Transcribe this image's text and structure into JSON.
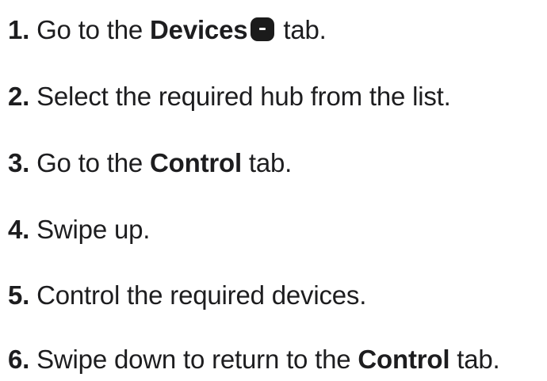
{
  "steps": [
    {
      "number": "1.",
      "text_before": " Go to the ",
      "bold": "Devices",
      "icon": "devices-tab-icon",
      "text_after": " tab."
    },
    {
      "number": "2.",
      "text": " Select the required hub from the list."
    },
    {
      "number": "3.",
      "text_before": " Go to the ",
      "bold": "Control",
      "text_after": " tab."
    },
    {
      "number": "4.",
      "text": " Swipe up."
    },
    {
      "number": "5.",
      "text": " Control the required devices."
    },
    {
      "number": "6.",
      "text_before": " Swipe down to return to the ",
      "bold": "Control",
      "text_after": " tab."
    }
  ]
}
